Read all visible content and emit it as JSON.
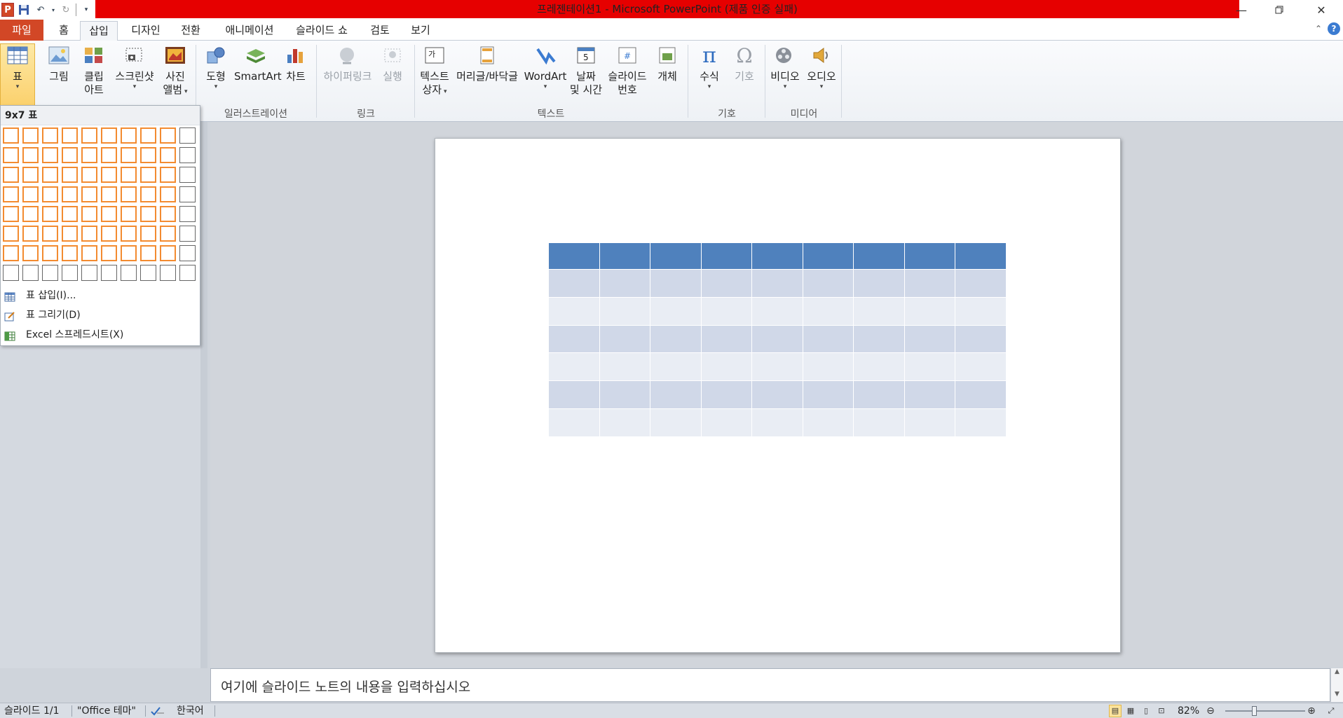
{
  "window": {
    "title": "프레젠테이션1 - Microsoft PowerPoint (제품 인증 실패)",
    "app_icon": "P",
    "accent": "#d24726",
    "title_bar_color": "#e60000"
  },
  "tabs": [
    {
      "label": "파일"
    },
    {
      "label": "홈"
    },
    {
      "label": "삽입"
    },
    {
      "label": "디자인"
    },
    {
      "label": "전환"
    },
    {
      "label": "애니메이션"
    },
    {
      "label": "슬라이드 쇼"
    },
    {
      "label": "검토"
    },
    {
      "label": "보기"
    }
  ],
  "active_tab": "삽입",
  "ribbon": {
    "table": {
      "label": "표"
    },
    "picture": {
      "label": "그림"
    },
    "clipart": {
      "label": "클립 아트",
      "line1": "클립",
      "line2": "아트"
    },
    "screenshot": {
      "label": "스크린샷"
    },
    "album": {
      "line1": "사진",
      "line2": "앨범"
    },
    "shapes": {
      "label": "도형"
    },
    "smartart": {
      "label": "SmartArt"
    },
    "chart": {
      "label": "차트"
    },
    "hyperlink": {
      "label": "하이퍼링크"
    },
    "action": {
      "label": "실행"
    },
    "textbox": {
      "line1": "텍스트",
      "line2": "상자"
    },
    "header_footer": {
      "label": "머리글/바닥글"
    },
    "wordart": {
      "label": "WordArt"
    },
    "datetime": {
      "line1": "날짜",
      "line2": "및 시간"
    },
    "slide_number": {
      "line1": "슬라이드",
      "line2": "번호"
    },
    "object": {
      "label": "개체"
    },
    "equation": {
      "label": "수식"
    },
    "symbol": {
      "label": "기호"
    },
    "video": {
      "label": "비디오"
    },
    "audio": {
      "label": "오디오"
    },
    "groups": {
      "illustrations": "일러스트레이션",
      "links": "링크",
      "text": "텍스트",
      "symbols": "기호",
      "media": "미디어"
    }
  },
  "table_dropdown": {
    "title": "9x7 표",
    "rows": 8,
    "cols": 10,
    "selected_cols": 9,
    "selected_rows": 7,
    "items": [
      {
        "label": "표 삽입(I)...",
        "icon": "insert-table-icon"
      },
      {
        "label": "표 그리기(D)",
        "icon": "draw-table-icon"
      },
      {
        "label": "Excel 스프레드시트(X)",
        "icon": "excel-sheet-icon"
      }
    ]
  },
  "slide_table": {
    "cols": 9,
    "rows": 7,
    "header_color": "#4f81bd",
    "band_dark": "#d0d8e8",
    "band_light": "#e9edf4"
  },
  "notes": {
    "placeholder": "여기에 슬라이드 노트의 내용을 입력하십시오"
  },
  "status": {
    "slide": "슬라이드 1/1",
    "theme": "\"Office 테마\"",
    "language": "한국어",
    "zoom": "82%"
  }
}
